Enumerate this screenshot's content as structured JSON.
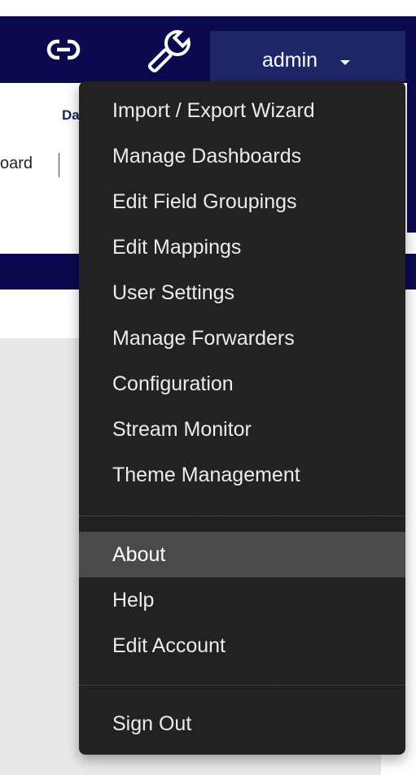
{
  "header": {
    "link_icon": "link-icon",
    "tools_icon": "wrench-icon",
    "user_label": "admin",
    "user_caret_icon": "caret-down-icon"
  },
  "background": {
    "tab_fragment": "Da",
    "board_fragment": "oard"
  },
  "menu": {
    "items": [
      {
        "label": "Import / Export Wizard"
      },
      {
        "label": "Manage Dashboards"
      },
      {
        "label": "Edit Field Groupings"
      },
      {
        "label": "Edit Mappings"
      },
      {
        "label": "User Settings"
      },
      {
        "label": "Manage Forwarders"
      },
      {
        "label": "Configuration"
      },
      {
        "label": "Stream Monitor"
      },
      {
        "label": "Theme Management"
      },
      {
        "label": "About",
        "active": true
      },
      {
        "label": "Help"
      },
      {
        "label": "Edit Account"
      },
      {
        "label": "Sign Out"
      }
    ]
  },
  "colors": {
    "navbar": "#0c0a4f",
    "user_button": "#1e2766",
    "menu_bg": "#222222",
    "menu_hover": "#4a4a4a",
    "menu_text": "#ececec"
  }
}
